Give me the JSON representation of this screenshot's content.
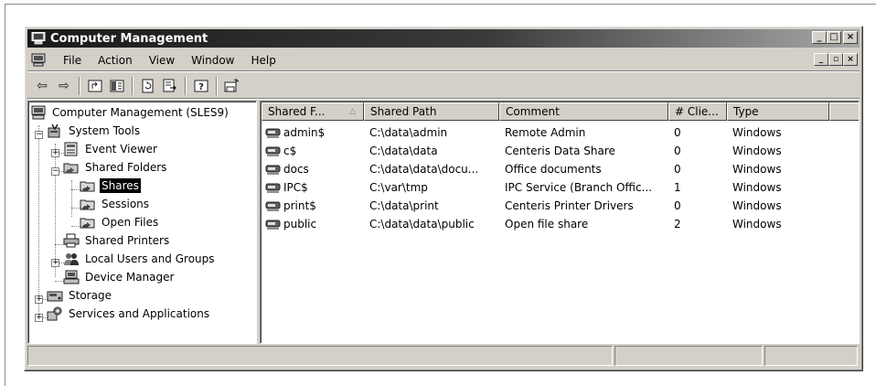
{
  "window": {
    "title": "Computer Management",
    "title_icon": "computer-management-icon",
    "buttons": {
      "minimize": "_",
      "maximize": "□",
      "close": "×"
    }
  },
  "menubar": {
    "icon": "mmc-console-icon",
    "items": [
      "File",
      "Action",
      "View",
      "Window",
      "Help"
    ],
    "mdi_buttons": {
      "minimize": "_",
      "restore": "▫",
      "close": "×"
    }
  },
  "toolbar": {
    "buttons": [
      "back-icon",
      "forward-icon",
      "up-one-level-icon",
      "show-hide-tree-icon",
      "refresh-icon",
      "export-list-icon",
      "help-icon",
      "new-share-icon"
    ],
    "glyphs": {
      "back": "⇦",
      "forward": "⇨",
      "up": "⬆",
      "tree": "▤",
      "refresh": "↻",
      "export": "⇲",
      "help": "?",
      "new_share": "✎"
    }
  },
  "tree": {
    "nodes": [
      {
        "label": "Computer Management (SLES9)",
        "icon": "computer-management-icon",
        "depth": 0,
        "expander": ""
      },
      {
        "label": "System Tools",
        "icon": "system-tools-icon",
        "depth": 1,
        "expander": "−"
      },
      {
        "label": "Event Viewer",
        "icon": "event-viewer-icon",
        "depth": 2,
        "expander": "+"
      },
      {
        "label": "Shared Folders",
        "icon": "shared-folders-icon",
        "depth": 2,
        "expander": "−"
      },
      {
        "label": "Shares",
        "icon": "shares-icon",
        "depth": 3,
        "expander": "",
        "selected": true
      },
      {
        "label": "Sessions",
        "icon": "sessions-icon",
        "depth": 3,
        "expander": ""
      },
      {
        "label": "Open Files",
        "icon": "open-files-icon",
        "depth": 3,
        "expander": ""
      },
      {
        "label": "Shared Printers",
        "icon": "shared-printers-icon",
        "depth": 2,
        "expander": ""
      },
      {
        "label": "Local Users and Groups",
        "icon": "local-users-groups-icon",
        "depth": 2,
        "expander": "+"
      },
      {
        "label": "Device Manager",
        "icon": "device-manager-icon",
        "depth": 2,
        "expander": ""
      },
      {
        "label": "Storage",
        "icon": "storage-icon",
        "depth": 1,
        "expander": "+"
      },
      {
        "label": "Services and Applications",
        "icon": "services-applications-icon",
        "depth": 1,
        "expander": "+"
      }
    ]
  },
  "list": {
    "columns": [
      "Shared F...",
      "Shared Path",
      "Comment",
      "# Clie...",
      "Type",
      ""
    ],
    "sort_indicator": "△",
    "rows": [
      {
        "name": "admin$",
        "path": "C:\\data\\admin",
        "comment": "Remote Admin",
        "clients": "0",
        "type": "Windows"
      },
      {
        "name": "c$",
        "path": "C:\\data\\data",
        "comment": "Centeris Data Share",
        "clients": "0",
        "type": "Windows"
      },
      {
        "name": "docs",
        "path": "C:\\data\\data\\docu...",
        "comment": "Office documents",
        "clients": "0",
        "type": "Windows"
      },
      {
        "name": "IPC$",
        "path": "C:\\var\\tmp",
        "comment": "IPC Service (Branch Offic...",
        "clients": "1",
        "type": "Windows"
      },
      {
        "name": "print$",
        "path": "C:\\data\\print",
        "comment": "Centeris Printer Drivers",
        "clients": "0",
        "type": "Windows"
      },
      {
        "name": "public",
        "path": "C:\\data\\data\\public",
        "comment": "Open file share",
        "clients": "2",
        "type": "Windows"
      }
    ]
  },
  "statusbar": {
    "panels": [
      "",
      "",
      ""
    ]
  }
}
